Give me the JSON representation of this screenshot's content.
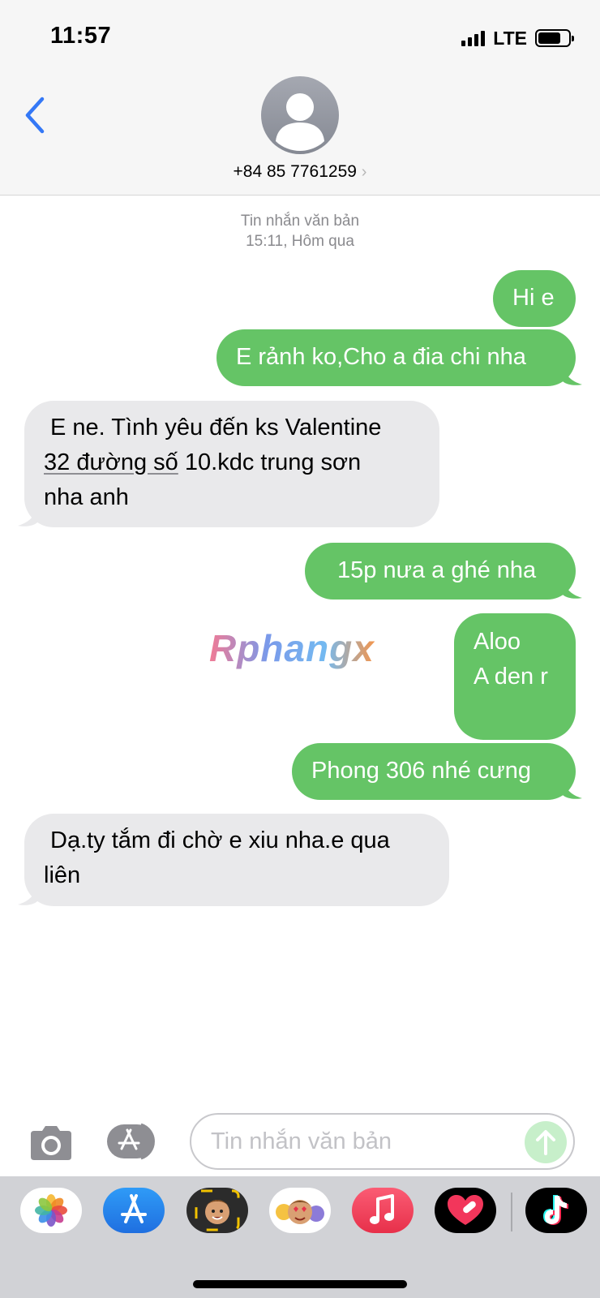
{
  "status_bar": {
    "time": "11:57",
    "network": "LTE",
    "battery_level": 0.75
  },
  "header": {
    "contact": "+84 85 7761259",
    "chevron": "›",
    "back_icon": "chevron-left-icon",
    "avatar_icon": "person-avatar-icon"
  },
  "thread": {
    "timestamp_title": "Tin nhắn văn bản",
    "timestamp_time": "15:11, Hôm qua",
    "messages": [
      {
        "dir": "out",
        "text": "Hi e"
      },
      {
        "dir": "out",
        "text": "E rảnh ko,Cho a đia chi nha"
      },
      {
        "dir": "in",
        "line1": "E ne. Tình yêu đến ks Valentine",
        "link": "32 đường số",
        "line2_rest": " 10.kdc trung sơn",
        "line3": "nha anh"
      },
      {
        "dir": "out",
        "text": "15p nưa  a ghé nha"
      },
      {
        "dir": "out",
        "line1": "Aloo",
        "line2": "A den r"
      },
      {
        "dir": "out",
        "text": "Phong 306 nhé cưng"
      },
      {
        "dir": "in",
        "line1": "Dạ.ty tắm đi chờ e xiu nha.e qua",
        "line2": "liên"
      }
    ]
  },
  "watermark": "Rphangx",
  "composer": {
    "placeholder": "Tin nhắn văn bản",
    "camera_icon": "camera-icon",
    "apps_icon": "app-store-icon",
    "send_icon": "arrow-up-icon"
  },
  "app_drawer": {
    "apps": [
      {
        "name": "photos-app-icon"
      },
      {
        "name": "app-store-app-icon"
      },
      {
        "name": "memoji-camera-app-icon"
      },
      {
        "name": "memoji-stickers-app-icon"
      },
      {
        "name": "music-app-icon"
      },
      {
        "name": "digital-touch-app-icon"
      },
      {
        "name": "tiktok-app-icon"
      }
    ]
  },
  "colors": {
    "outgoing": "#65c466",
    "incoming": "#e9e9eb",
    "accent": "#3478f6"
  }
}
